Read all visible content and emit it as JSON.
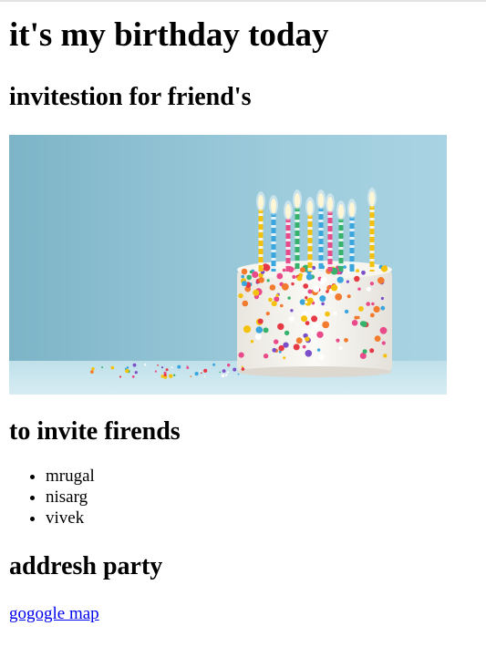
{
  "page": {
    "title": "it's my birthday today",
    "invitation_heading": "invitestion for friend's",
    "friends_heading": "to invite firends",
    "friends": [
      "mrugal",
      "nisarg",
      "vivek"
    ],
    "address_heading": "addresh party",
    "map_link_text": "gogogle map"
  },
  "image": {
    "subject": "birthday-cake-with-candles",
    "background_color": "#8fc3d3"
  },
  "colors": {
    "link": "#0000ee",
    "text": "#000000"
  }
}
